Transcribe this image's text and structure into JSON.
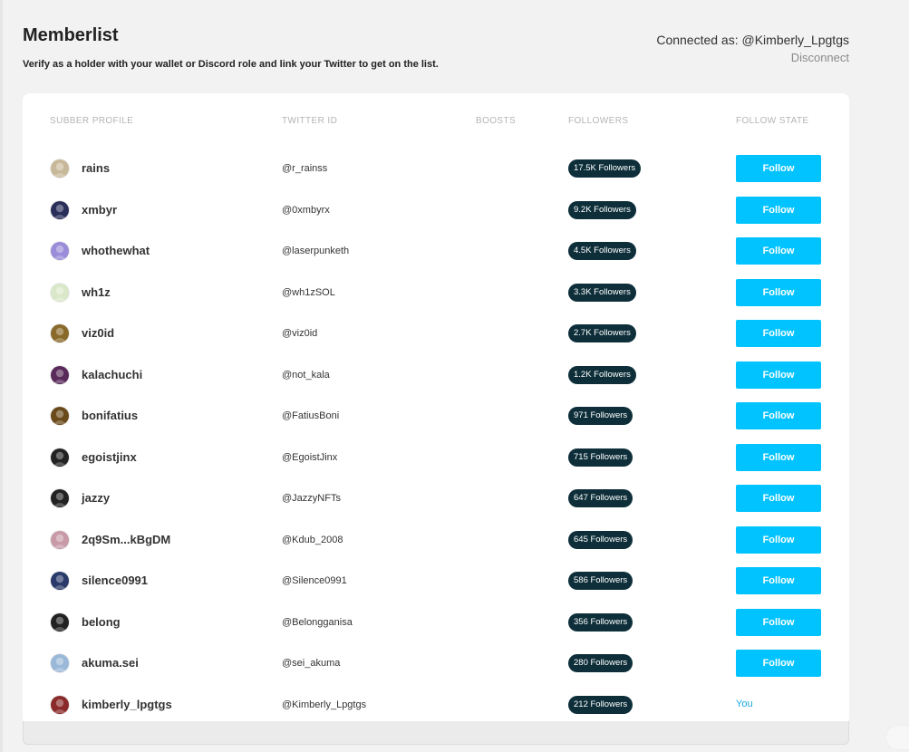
{
  "header": {
    "title": "Memberlist",
    "subtitle": "Verify as a holder with your wallet or Discord role and link your Twitter to get on the list.",
    "connected_label": "Connected as: @Kimberly_Lpgtgs",
    "disconnect_label": "Disconnect"
  },
  "table": {
    "columns": [
      "SUBBER PROFILE",
      "TWITTER ID",
      "BOOSTS",
      "FOLLOWERS",
      "FOLLOW STATE"
    ],
    "rows": [
      {
        "name": "rains",
        "twitter": "@r_rainss",
        "followers": "17.5K Followers",
        "state": "Follow",
        "avatar": "#c8b89a"
      },
      {
        "name": "xmbyr",
        "twitter": "@0xmbyrx",
        "followers": "9.2K Followers",
        "state": "Follow",
        "avatar": "#2a2f5a"
      },
      {
        "name": "whothewhat",
        "twitter": "@laserpunketh",
        "followers": "4.5K Followers",
        "state": "Follow",
        "avatar": "#9a8cd8"
      },
      {
        "name": "wh1z",
        "twitter": "@wh1zSOL",
        "followers": "3.3K Followers",
        "state": "Follow",
        "avatar": "#d9e8c8"
      },
      {
        "name": "viz0id",
        "twitter": "@viz0id",
        "followers": "2.7K Followers",
        "state": "Follow",
        "avatar": "#8a6a2a"
      },
      {
        "name": "kalachuchi",
        "twitter": "@not_kala",
        "followers": "1.2K Followers",
        "state": "Follow",
        "avatar": "#5a2a5a"
      },
      {
        "name": "bonifatius",
        "twitter": "@FatiusBoni",
        "followers": "971 Followers",
        "state": "Follow",
        "avatar": "#6a4a1a"
      },
      {
        "name": "egoistjinx",
        "twitter": "@EgoistJinx",
        "followers": "715 Followers",
        "state": "Follow",
        "avatar": "#222222"
      },
      {
        "name": "jazzy",
        "twitter": "@JazzyNFTs",
        "followers": "647 Followers",
        "state": "Follow",
        "avatar": "#222222"
      },
      {
        "name": "2q9Sm...kBgDM",
        "twitter": "@Kdub_2008",
        "followers": "645 Followers",
        "state": "Follow",
        "avatar": "#c89aa8"
      },
      {
        "name": "silence0991",
        "twitter": "@Silence0991",
        "followers": "586 Followers",
        "state": "Follow",
        "avatar": "#2a3a6a"
      },
      {
        "name": "belong",
        "twitter": "@Belongganisa",
        "followers": "356 Followers",
        "state": "Follow",
        "avatar": "#222222"
      },
      {
        "name": "akuma.sei",
        "twitter": "@sei_akuma",
        "followers": "280 Followers",
        "state": "Follow",
        "avatar": "#9ab8d8"
      },
      {
        "name": "kimberly_lpgtgs",
        "twitter": "@Kimberly_Lpgtgs",
        "followers": "212 Followers",
        "state": "You",
        "avatar": "#8a2a2a"
      }
    ]
  }
}
